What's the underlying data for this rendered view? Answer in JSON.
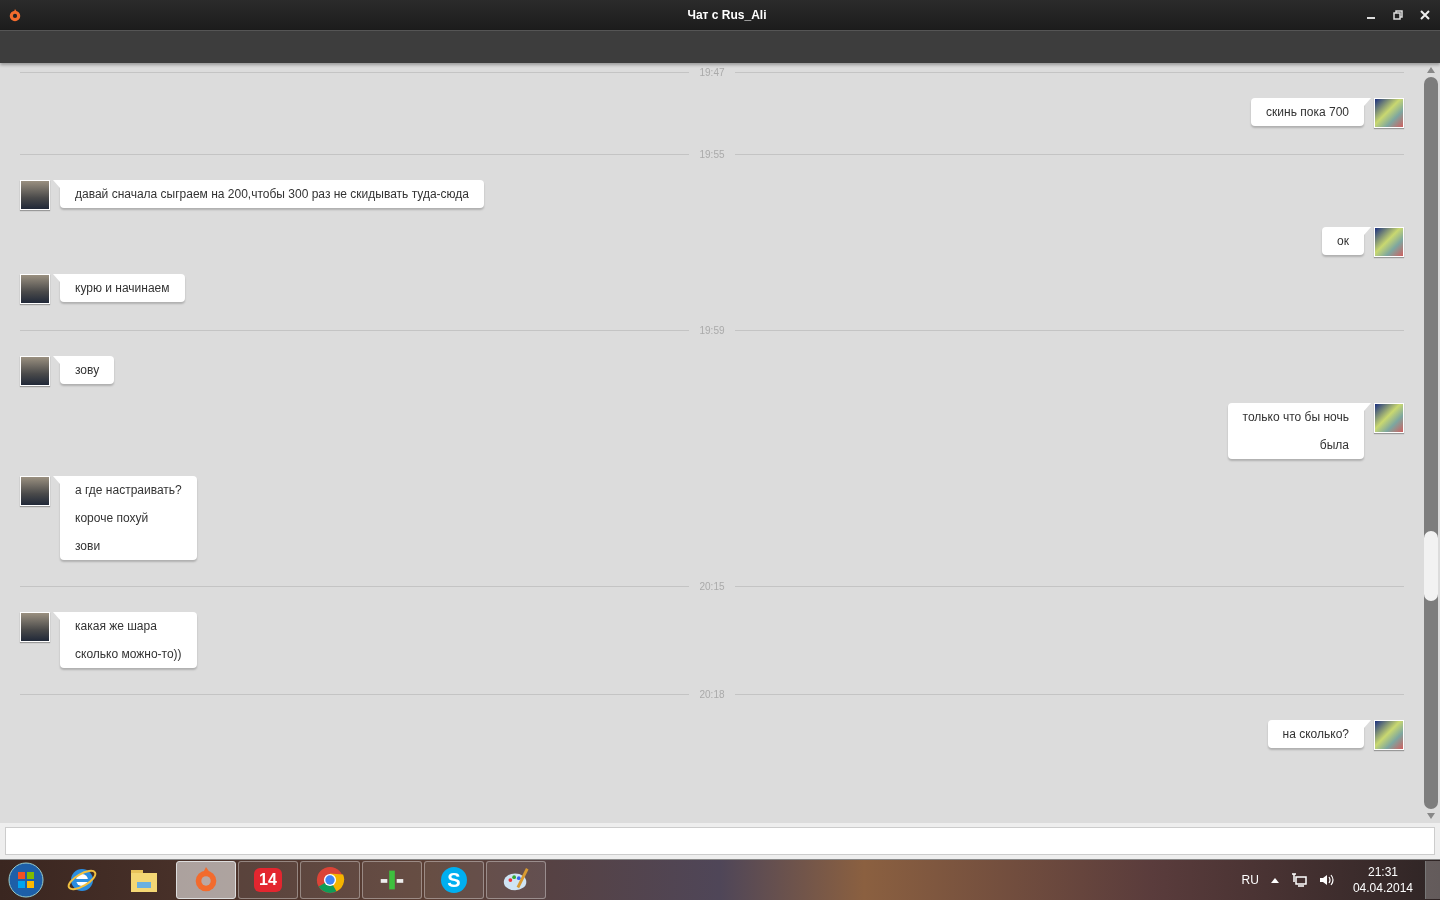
{
  "window": {
    "title": "Чат с Rus_Ali"
  },
  "messages": [
    {
      "kind": "time",
      "text": "19:47"
    },
    {
      "kind": "message",
      "outgoing": true,
      "lines": [
        "скинь пока 700"
      ]
    },
    {
      "kind": "time",
      "text": "19:55"
    },
    {
      "kind": "message",
      "outgoing": false,
      "lines": [
        "давай сначала сыграем на 200,чтобы 300 раз не скидывать туда-сюда"
      ]
    },
    {
      "kind": "message",
      "outgoing": true,
      "lines": [
        "ок"
      ]
    },
    {
      "kind": "message",
      "outgoing": false,
      "lines": [
        "курю и начинаем"
      ]
    },
    {
      "kind": "time",
      "text": "19:59"
    },
    {
      "kind": "message",
      "outgoing": false,
      "lines": [
        "зову"
      ]
    },
    {
      "kind": "message",
      "outgoing": true,
      "lines": [
        "только что бы ночь",
        "была"
      ]
    },
    {
      "kind": "message",
      "outgoing": false,
      "lines": [
        "а где настраивать?",
        "короче похуй",
        "зови"
      ]
    },
    {
      "kind": "time",
      "text": "20:15"
    },
    {
      "kind": "message",
      "outgoing": false,
      "lines": [
        "какая же шара",
        "сколько можно-то))"
      ]
    },
    {
      "kind": "time",
      "text": "20:18"
    },
    {
      "kind": "message",
      "outgoing": true,
      "lines": [
        "на сколько?"
      ]
    }
  ],
  "taskbar": {
    "items": [
      {
        "kind": "ie",
        "selected": false
      },
      {
        "kind": "folder",
        "selected": false
      },
      {
        "kind": "origin",
        "selected": true
      },
      {
        "kind": "badge",
        "label": "14",
        "selected": false
      },
      {
        "kind": "chrome",
        "selected": false
      },
      {
        "kind": "bars",
        "selected": false
      },
      {
        "kind": "skype",
        "label": "S",
        "selected": false
      },
      {
        "kind": "paint",
        "selected": false
      }
    ],
    "language": "RU",
    "time": "21:31",
    "date": "04.04.2014"
  }
}
